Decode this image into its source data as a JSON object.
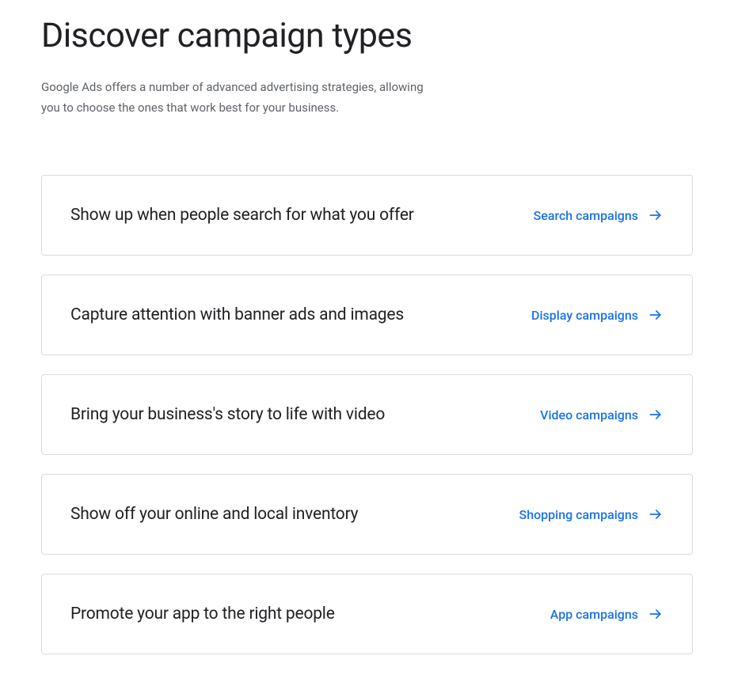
{
  "header": {
    "title": "Discover campaign types",
    "description": "Google Ads offers a number of advanced advertising strategies, allowing you to choose the ones that work best for your business."
  },
  "cards": [
    {
      "title": "Show up when people search for what you offer",
      "link_label": "Search campaigns"
    },
    {
      "title": "Capture attention with banner ads and images",
      "link_label": "Display campaigns"
    },
    {
      "title": "Bring your business's story to life with video",
      "link_label": "Video campaigns"
    },
    {
      "title": "Show off your online and local inventory",
      "link_label": "Shopping campaigns"
    },
    {
      "title": "Promote your app to the right people",
      "link_label": "App campaigns"
    }
  ]
}
